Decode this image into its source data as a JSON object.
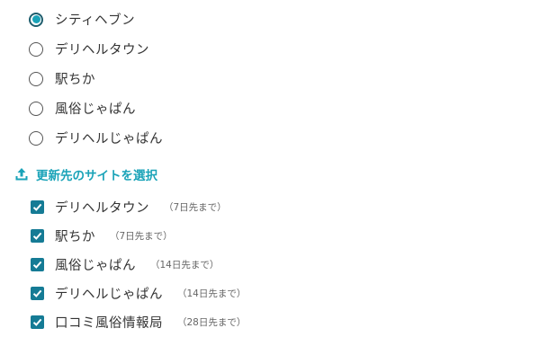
{
  "radio_group": {
    "options": [
      {
        "label": "シティヘブン",
        "selected": true
      },
      {
        "label": "デリヘルタウン",
        "selected": false
      },
      {
        "label": "駅ちか",
        "selected": false
      },
      {
        "label": "風俗じゃぱん",
        "selected": false
      },
      {
        "label": "デリヘルじゃぱん",
        "selected": false
      }
    ]
  },
  "update_section": {
    "heading": "更新先のサイトを選択",
    "icon": "upload-icon",
    "accent_color": "#1aa3b8",
    "sites": [
      {
        "label": "デリヘルタウン",
        "note": "（7日先まで）",
        "checked": true
      },
      {
        "label": "駅ちか",
        "note": "（7日先まで）",
        "checked": true
      },
      {
        "label": "風俗じゃぱん",
        "note": "（14日先まで）",
        "checked": true
      },
      {
        "label": "デリヘルじゃぱん",
        "note": "（14日先まで）",
        "checked": true
      },
      {
        "label": "口コミ風俗情報局",
        "note": "（28日先まで）",
        "checked": true
      }
    ]
  }
}
